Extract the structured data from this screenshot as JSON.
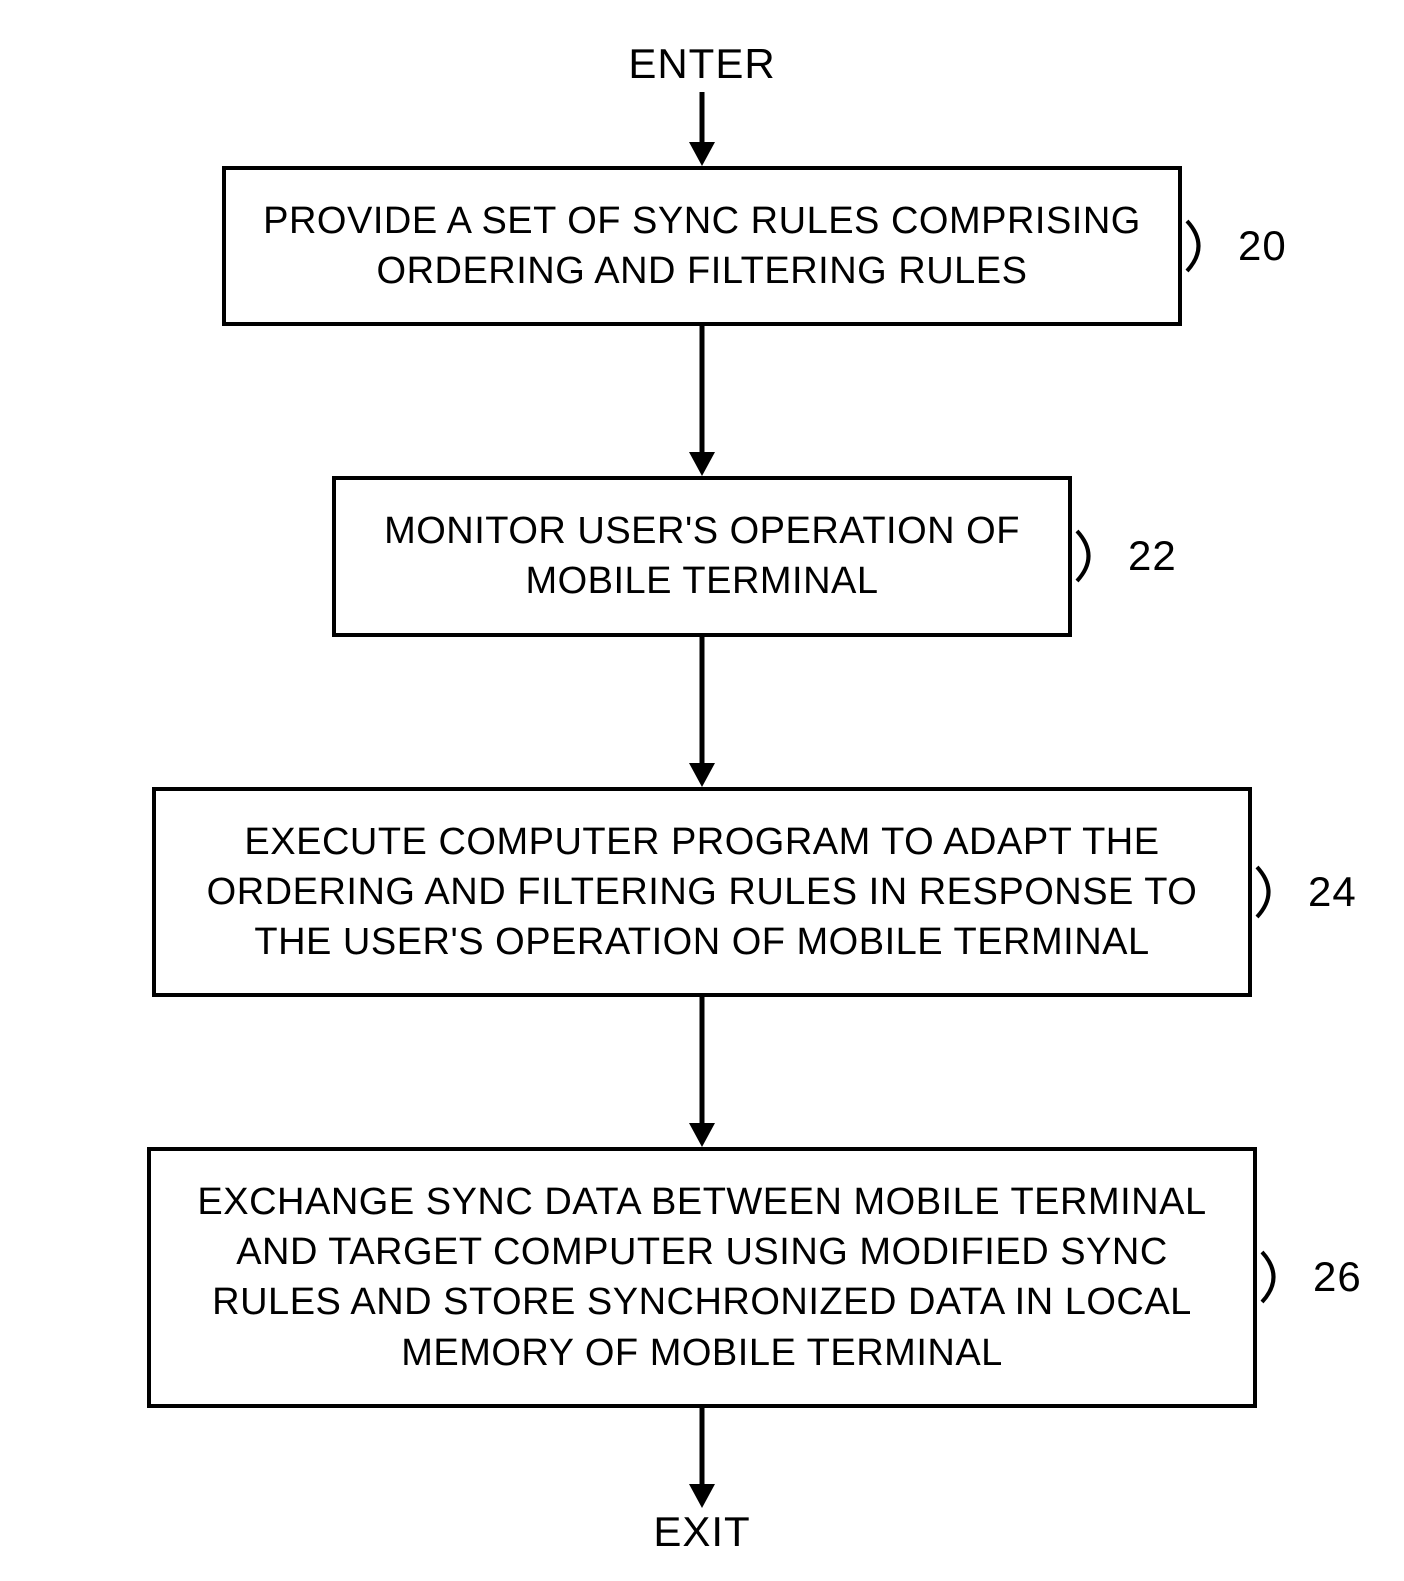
{
  "chart_data": {
    "type": "flowchart",
    "title": "",
    "direction": "top-to-bottom",
    "nodes": [
      {
        "id": "enter",
        "type": "terminal",
        "label": "ENTER"
      },
      {
        "id": "20",
        "type": "process",
        "ref": "20",
        "label": "PROVIDE A SET OF SYNC RULES COMPRISING ORDERING AND FILTERING RULES"
      },
      {
        "id": "22",
        "type": "process",
        "ref": "22",
        "label": "MONITOR USER'S OPERATION OF MOBILE TERMINAL"
      },
      {
        "id": "24",
        "type": "process",
        "ref": "24",
        "label": "EXECUTE COMPUTER PROGRAM TO ADAPT THE ORDERING AND FILTERING RULES IN RESPONSE TO THE USER'S OPERATION OF MOBILE TERMINAL"
      },
      {
        "id": "26",
        "type": "process",
        "ref": "26",
        "label": "EXCHANGE SYNC DATA BETWEEN MOBILE TERMINAL AND TARGET COMPUTER USING MODIFIED SYNC RULES AND STORE SYNCHRONIZED DATA IN LOCAL MEMORY OF MOBILE TERMINAL"
      },
      {
        "id": "exit",
        "type": "terminal",
        "label": "EXIT"
      }
    ],
    "edges": [
      {
        "from": "enter",
        "to": "20"
      },
      {
        "from": "20",
        "to": "22"
      },
      {
        "from": "22",
        "to": "24"
      },
      {
        "from": "24",
        "to": "26"
      },
      {
        "from": "26",
        "to": "exit"
      }
    ]
  }
}
